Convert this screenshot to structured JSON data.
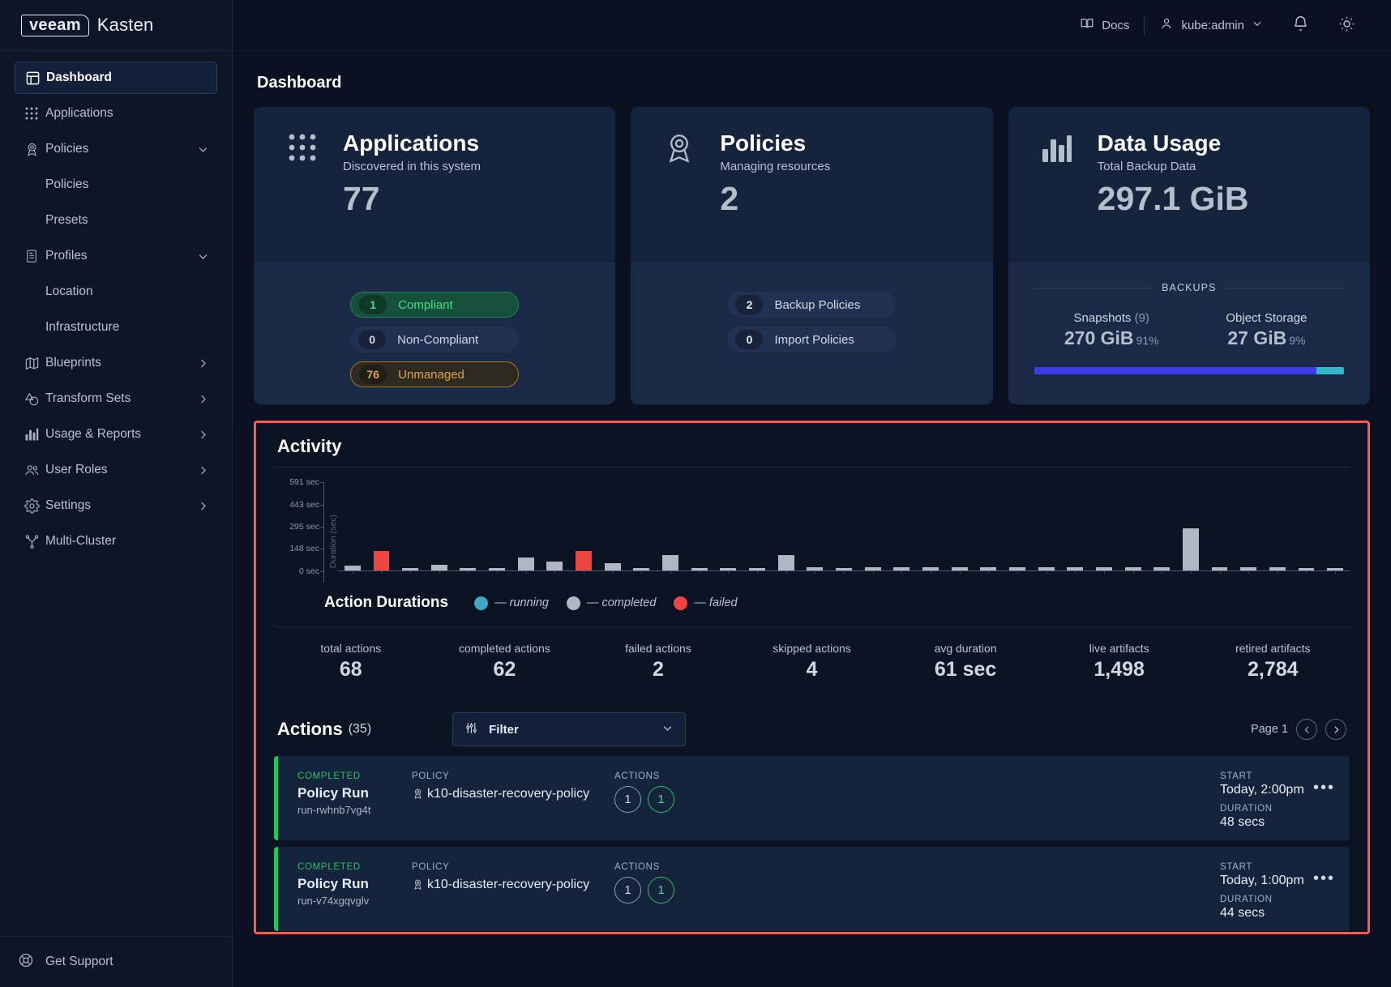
{
  "brand": {
    "veeam": "veeam",
    "kasten": "Kasten"
  },
  "topbar": {
    "docs": "Docs",
    "user": "kube:admin",
    "icons": [
      "book-icon",
      "user-icon",
      "chevron-down-icon",
      "bell-icon",
      "sun-icon"
    ]
  },
  "sidebar": {
    "items": [
      {
        "label": "Dashboard",
        "icon": "dashboard-icon",
        "active": true,
        "sub": false,
        "chev": ""
      },
      {
        "label": "Applications",
        "icon": "grid-icon",
        "active": false,
        "sub": false,
        "chev": ""
      },
      {
        "label": "Policies",
        "icon": "ribbon-icon",
        "active": false,
        "sub": false,
        "chev": "down"
      },
      {
        "label": "Policies",
        "icon": "",
        "active": false,
        "sub": true,
        "chev": ""
      },
      {
        "label": "Presets",
        "icon": "",
        "active": false,
        "sub": true,
        "chev": ""
      },
      {
        "label": "Profiles",
        "icon": "document-icon",
        "active": false,
        "sub": false,
        "chev": "down"
      },
      {
        "label": "Location",
        "icon": "",
        "active": false,
        "sub": true,
        "chev": ""
      },
      {
        "label": "Infrastructure",
        "icon": "",
        "active": false,
        "sub": true,
        "chev": ""
      },
      {
        "label": "Blueprints",
        "icon": "map-icon",
        "active": false,
        "sub": false,
        "chev": "right"
      },
      {
        "label": "Transform Sets",
        "icon": "shapes-icon",
        "active": false,
        "sub": false,
        "chev": "right"
      },
      {
        "label": "Usage & Reports",
        "icon": "bar-chart-icon",
        "active": false,
        "sub": false,
        "chev": "right"
      },
      {
        "label": "User Roles",
        "icon": "users-icon",
        "active": false,
        "sub": false,
        "chev": "right"
      },
      {
        "label": "Settings",
        "icon": "gear-icon",
        "active": false,
        "sub": false,
        "chev": "right"
      },
      {
        "label": "Multi-Cluster",
        "icon": "cluster-icon",
        "active": false,
        "sub": false,
        "chev": ""
      }
    ],
    "support": {
      "label": "Get Support",
      "icon": "lifebuoy-icon"
    }
  },
  "page": {
    "title": "Dashboard"
  },
  "cards": {
    "applications": {
      "icon": "grid-icon",
      "title": "Applications",
      "subtitle": "Discovered in this system",
      "value": "77",
      "pills": [
        {
          "count": "1",
          "label": "Compliant",
          "style": "compliant"
        },
        {
          "count": "0",
          "label": "Non-Compliant",
          "style": "noncompliant"
        },
        {
          "count": "76",
          "label": "Unmanaged",
          "style": "unmanaged"
        }
      ]
    },
    "policies": {
      "icon": "ribbon-icon",
      "title": "Policies",
      "subtitle": "Managing resources",
      "value": "2",
      "pills": [
        {
          "count": "2",
          "label": "Backup Policies"
        },
        {
          "count": "0",
          "label": "Import Policies"
        }
      ]
    },
    "data_usage": {
      "icon": "bar-chart-icon",
      "title": "Data Usage",
      "subtitle": "Total Backup Data",
      "value": "297.1 GiB",
      "backups_label": "BACKUPS",
      "snapshots": {
        "label": "Snapshots",
        "count": "(9)",
        "value": "270 GiB",
        "pct": "91%"
      },
      "object_storage": {
        "label": "Object Storage",
        "count": "",
        "value": "27 GiB",
        "pct": "9%"
      },
      "bar": {
        "snapshot_pct": 91,
        "object_pct": 9,
        "snapshot_color": "#3b3ee8",
        "object_color": "#35b6cb"
      }
    }
  },
  "activity": {
    "title": "Activity",
    "legend_title": "Action Durations",
    "legend": [
      {
        "label": "— running",
        "color": "#3fa8c4"
      },
      {
        "label": "— completed",
        "color": "#aeb8c4"
      },
      {
        "label": "— failed",
        "color": "#ef4444"
      }
    ],
    "stats": [
      {
        "label": "total actions",
        "value": "68"
      },
      {
        "label": "completed actions",
        "value": "62"
      },
      {
        "label": "failed actions",
        "value": "2"
      },
      {
        "label": "skipped actions",
        "value": "4"
      },
      {
        "label": "avg duration",
        "value": "61 sec"
      },
      {
        "label": "live artifacts",
        "value": "1,498"
      },
      {
        "label": "retired artifacts",
        "value": "2,784"
      }
    ]
  },
  "chart_data": {
    "type": "bar",
    "title": "Action Durations",
    "xlabel": "",
    "ylabel": "Duration (sec)",
    "ylim": [
      0,
      591
    ],
    "yticks": [
      0,
      148,
      295,
      443,
      591
    ],
    "ytick_labels": [
      "0 sec",
      "148 sec",
      "295 sec",
      "443 sec",
      "591 sec"
    ],
    "grid": false,
    "legend_position": "below",
    "series": [
      {
        "name": "running",
        "color": "#3fa8c4"
      },
      {
        "name": "completed",
        "color": "#aeb8c4"
      },
      {
        "name": "failed",
        "color": "#ef4444"
      }
    ],
    "values": [
      30,
      130,
      14,
      40,
      15,
      14,
      85,
      57,
      130,
      48,
      15,
      100,
      12,
      14,
      15,
      100,
      22,
      17,
      19,
      20,
      22,
      22,
      20,
      20,
      22,
      19,
      20,
      19,
      20,
      280,
      19,
      19,
      19,
      12,
      9
    ],
    "colors": [
      "completed",
      "failed",
      "completed",
      "completed",
      "completed",
      "completed",
      "completed",
      "completed",
      "failed",
      "completed",
      "completed",
      "completed",
      "completed",
      "completed",
      "completed",
      "completed",
      "completed",
      "completed",
      "completed",
      "completed",
      "completed",
      "completed",
      "completed",
      "completed",
      "completed",
      "completed",
      "completed",
      "completed",
      "completed",
      "completed",
      "completed",
      "completed",
      "completed",
      "completed",
      "completed"
    ]
  },
  "actions": {
    "title": "Actions",
    "count": "(35)",
    "filter": {
      "label": "Filter",
      "icon": "filter-icon",
      "chevron": "chevron-down-icon"
    },
    "pager": {
      "label": "Page 1",
      "prev": "chevron-left-icon",
      "next": "chevron-right-icon"
    },
    "columns": {
      "policy": "POLICY",
      "actions": "ACTIONS",
      "start": "START",
      "duration": "DURATION"
    },
    "rows": [
      {
        "status": "COMPLETED",
        "type": "Policy Run",
        "id": "run-rwhnb7vg4t",
        "policy": "k10-disaster-recovery-policy",
        "policy_icon": "ribbon-icon",
        "circles": [
          "1",
          "1"
        ],
        "start": "Today, 2:00pm",
        "duration": "48 secs",
        "menu": "more-icon"
      },
      {
        "status": "COMPLETED",
        "type": "Policy Run",
        "id": "run-v74xgqvglv",
        "policy": "k10-disaster-recovery-policy",
        "policy_icon": "ribbon-icon",
        "circles": [
          "1",
          "1"
        ],
        "start": "Today, 1:00pm",
        "duration": "44 secs",
        "menu": "more-icon"
      }
    ]
  }
}
